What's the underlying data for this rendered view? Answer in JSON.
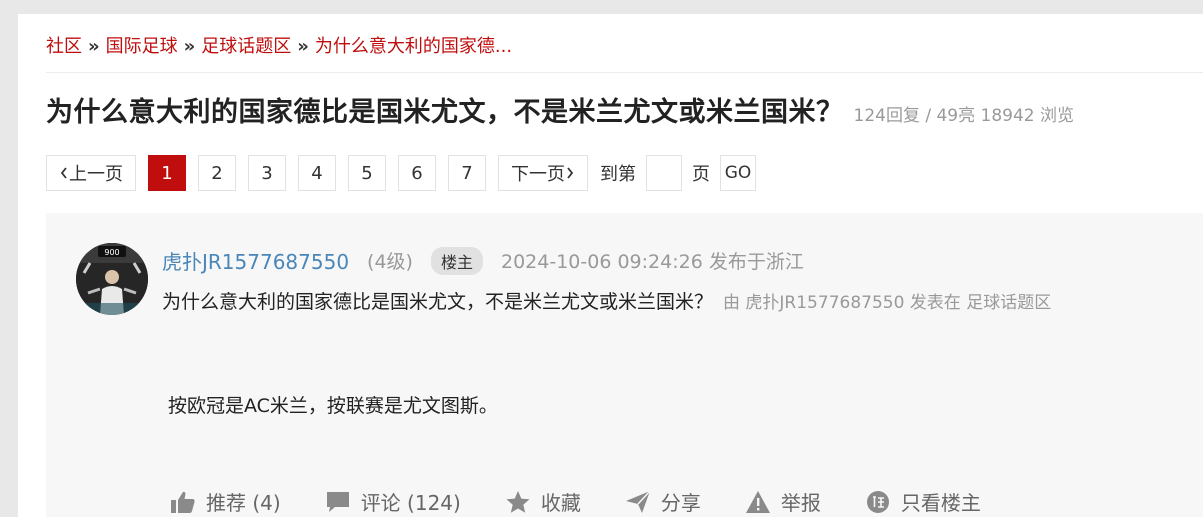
{
  "breadcrumb": {
    "items": [
      "社区",
      "国际足球",
      "足球话题区",
      "为什么意大利的国家德..."
    ],
    "separator": "»"
  },
  "thread": {
    "title": "为什么意大利的国家德比是国米尤文，不是米兰尤文或米兰国米？",
    "stats": "124回复 / 49亮 18942 浏览"
  },
  "pager": {
    "prev": "上一页",
    "pages": [
      "1",
      "2",
      "3",
      "4",
      "5",
      "6",
      "7"
    ],
    "current": "1",
    "next": "下一页",
    "goto_prefix": "到第",
    "goto_suffix": "页",
    "go": "GO"
  },
  "post": {
    "avatar_text": "900",
    "username": "虎扑JR1577687550",
    "level": "(4级)",
    "op_badge": "楼主",
    "time": "2024-10-06 09:24:26 发布于浙江",
    "subject": "为什么意大利的国家德比是国米尤文，不是米兰尤文或米兰国米？",
    "posted_by": "由  虎扑JR1577687550 发表在  足球话题区",
    "content": "按欧冠是AC米兰，按联赛是尤文图斯。",
    "actions": {
      "recommend": "推荐 (4)",
      "comment": "评论 (124)",
      "favorite": "收藏",
      "share": "分享",
      "report": "举报",
      "only_op": "只看楼主"
    }
  },
  "colors": {
    "accent": "#c00e0e",
    "username": "#4a86b8",
    "muted": "#999999",
    "post_bg": "#f7f7f7"
  },
  "icons": [
    "chevron-left-icon",
    "chevron-right-icon",
    "thumbs-up-icon",
    "comment-icon",
    "star-icon",
    "share-icon",
    "warning-icon",
    "only-op-icon"
  ]
}
